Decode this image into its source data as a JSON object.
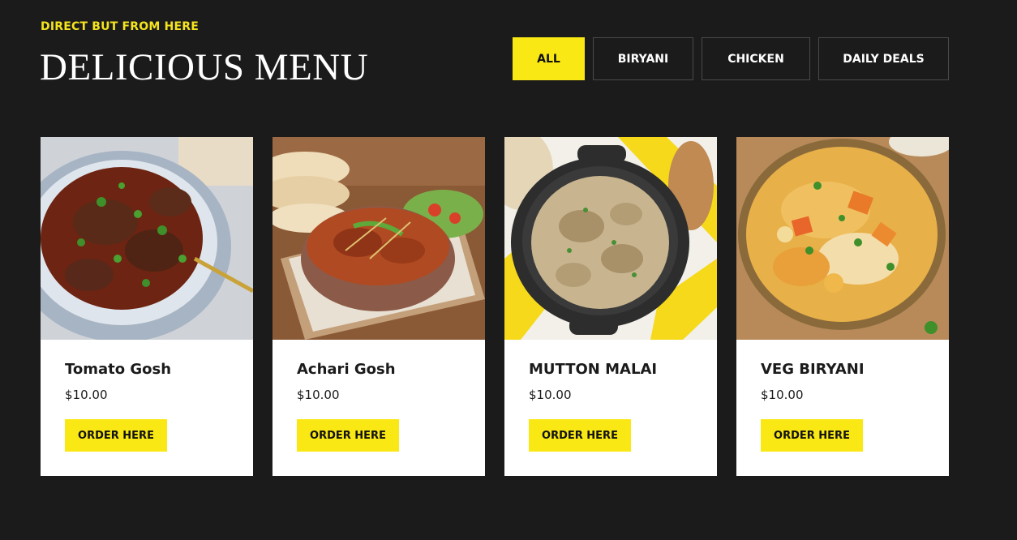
{
  "header": {
    "eyebrow": "DIRECT BUT FROM HERE",
    "title": "DELICIOUS MENU"
  },
  "filters": [
    {
      "label": "ALL",
      "active": true
    },
    {
      "label": "BIRYANI",
      "active": false
    },
    {
      "label": "CHICKEN",
      "active": false
    },
    {
      "label": "DAILY DEALS",
      "active": false
    }
  ],
  "menu": {
    "items": [
      {
        "name": "Tomato Gosh",
        "price": "$10.00",
        "button": "ORDER HERE",
        "image": "tomato-gosh-photo"
      },
      {
        "name": "Achari Gosh",
        "price": "$10.00",
        "button": "ORDER HERE",
        "image": "achari-gosh-photo"
      },
      {
        "name": "MUTTON MALAI",
        "price": "$10.00",
        "button": "ORDER HERE",
        "image": "mutton-malai-photo"
      },
      {
        "name": "VEG BIRYANI",
        "price": "$10.00",
        "button": "ORDER HERE",
        "image": "veg-biryani-photo"
      }
    ]
  },
  "colors": {
    "background": "#1b1b1b",
    "accent": "#f9e814",
    "eyebrow": "#f5e41d",
    "card": "#ffffff"
  }
}
